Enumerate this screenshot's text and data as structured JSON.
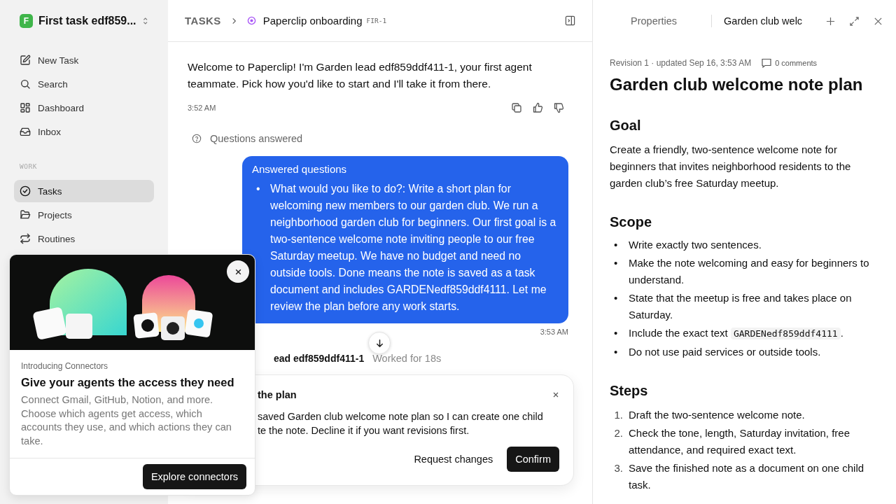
{
  "sidebar": {
    "workspace": {
      "initial": "F",
      "name": "First task edf859..."
    },
    "nav": [
      {
        "label": "New Task",
        "selected": false
      },
      {
        "label": "Search",
        "selected": false
      },
      {
        "label": "Dashboard",
        "selected": false
      },
      {
        "label": "Inbox",
        "selected": false
      }
    ],
    "section": "WORK",
    "work_items": [
      {
        "label": "Tasks",
        "selected": true
      },
      {
        "label": "Projects",
        "selected": false
      },
      {
        "label": "Routines",
        "selected": false
      }
    ]
  },
  "promo": {
    "kind": "picture",
    "eyebrow": "Introducing Connectors",
    "title": "Give your agents the access they need",
    "body": "Connect Gmail, GitHub, Notion, and more. Choose which agents get access, which accounts they use, and which actions they can take.",
    "button": "Explore connectors"
  },
  "breadcrumb": {
    "root": "TASKS",
    "title": "Paperclip onboarding",
    "id": "FIR-1"
  },
  "chat": {
    "message": "Welcome to Paperclip! I'm Garden lead edf859ddf411-1, your first agent teammate. Pick how you'd like to start and I'll take it from there.",
    "time": "3:52 AM",
    "event": "Questions answered",
    "answer": {
      "title": "Answered questions",
      "marker": "•",
      "items": [
        "What would you like to do?: Write a short plan for welcoming new members to our garden club. We run a neighborhood garden club for beginners. Our first goal is a two-sentence welcome note inviting people to our free Saturday meetup. We have no budget and need no outside tools. Done means the note is saved as a task document and includes GARDENedf859ddf4111. Let me review the plan before any work starts."
      ],
      "time": "3:53 AM"
    },
    "next_author": "ead edf859ddf411-1",
    "next_status": "Worked for 18s"
  },
  "confirm": {
    "title": "the plan",
    "lines": [
      "saved Garden club welcome note plan so I can create one child",
      "te the note. Decline it if you want revisions first."
    ],
    "secondary": "Request changes",
    "primary": "Confirm"
  },
  "panel": {
    "tabs": [
      {
        "label": "Properties",
        "selected": false
      },
      {
        "label": "Garden club welc",
        "selected": true
      }
    ],
    "meta": "Revision 1 · updated Sep 16, 3:53 AM",
    "comments": "0 comments",
    "title": "Garden club welcome note plan",
    "sections": [
      {
        "heading": "Goal",
        "kind": "paragraph",
        "text": "Create a friendly, two-sentence welcome note for beginners that invites neighborhood residents to the garden club’s free Saturday meetup."
      },
      {
        "heading": "Scope",
        "kind": "bullets",
        "marker": "•",
        "items": [
          {
            "text": "Write exactly two sentences."
          },
          {
            "text": "Make the note welcoming and easy for beginners to understand."
          },
          {
            "text": "State that the meetup is free and takes place on Saturday."
          },
          {
            "text": "Include the exact text ",
            "code": "GARDENedf859ddf4111",
            "after": "."
          },
          {
            "text": "Do not use paid services or outside tools."
          }
        ]
      },
      {
        "heading": "Steps",
        "kind": "numbered",
        "items": [
          {
            "number": "1.",
            "text": "Draft the two-sentence welcome note."
          },
          {
            "number": "2.",
            "text": "Check the tone, length, Saturday invitation, free attendance, and required exact text."
          },
          {
            "number": "3.",
            "text": "Save the finished note as a document on one child task."
          }
        ]
      }
    ]
  }
}
